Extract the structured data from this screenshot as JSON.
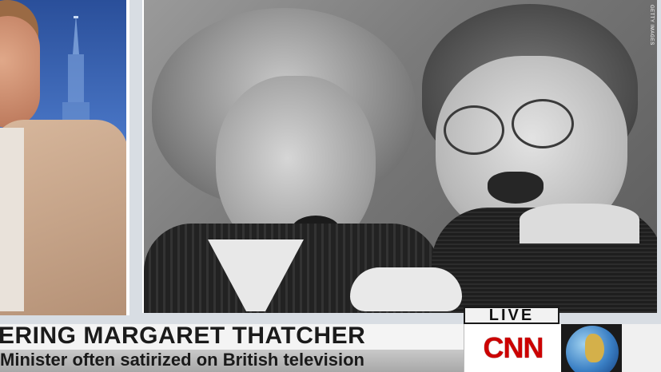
{
  "photo": {
    "credit": "GETTY IMAGES"
  },
  "lower_third": {
    "live_label": "LIVE",
    "headline": "ERING MARGARET THATCHER",
    "subline": "Minister often satirized on British television"
  },
  "network": {
    "logo_text": "CNN",
    "brand_color": "#cc0000"
  },
  "icons": [
    "church-spire-icon",
    "globe-icon"
  ]
}
